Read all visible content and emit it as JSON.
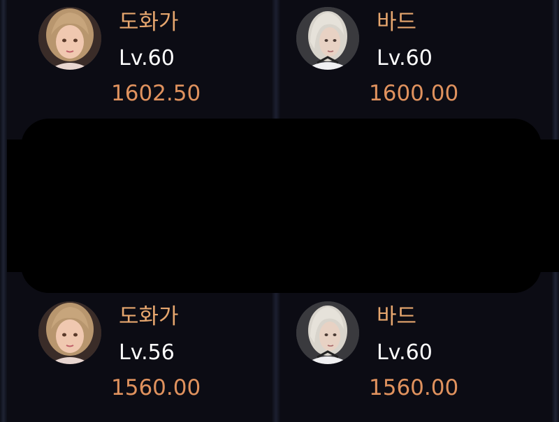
{
  "characters": [
    {
      "class_name": "도화가",
      "level": "Lv.60",
      "item_level": "1602.50",
      "portrait": "artist-portrait-icon"
    },
    {
      "class_name": "바드",
      "level": "Lv.60",
      "item_level": "1600.00",
      "portrait": "bard-portrait-icon"
    },
    {
      "class_name": "도화가",
      "level": "Lv.56",
      "item_level": "1560.00",
      "portrait": "artist-portrait-icon"
    },
    {
      "class_name": "바드",
      "level": "Lv.60",
      "item_level": "1560.00",
      "portrait": "bard-portrait-icon"
    }
  ],
  "colors": {
    "class_name": "#e6a66e",
    "level": "#ffffff",
    "item_level": "#e0925e",
    "background": "#0c0c14"
  }
}
